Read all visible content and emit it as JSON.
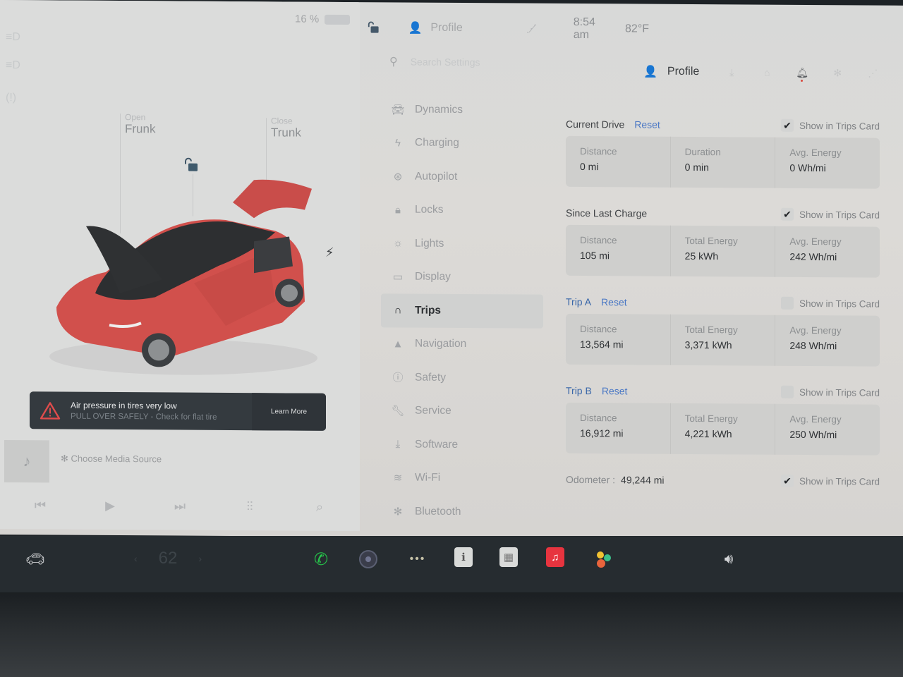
{
  "status_bar": {
    "battery_percent": "16 %",
    "profile_label": "Profile",
    "time": "8:54 am",
    "outside_temp": "82°F"
  },
  "left_panel": {
    "frunk": {
      "action": "Open",
      "label": "Frunk"
    },
    "trunk": {
      "action": "Close",
      "label": "Trunk"
    },
    "icons": [
      "low-beam-icon",
      "fog-light-icon",
      "tire-pressure-icon",
      "unlock-icon",
      "charge-port-icon"
    ],
    "alert": {
      "title": "Air pressure in tires very low",
      "subtitle": "PULL OVER SAFELY - Check for flat tire",
      "button": "Learn More"
    },
    "media": {
      "source_label": "Choose Media Source",
      "controls": [
        "previous",
        "play",
        "next",
        "equalizer",
        "search"
      ]
    }
  },
  "settings": {
    "search_placeholder": "Search Settings",
    "header": {
      "profile_label": "Profile",
      "icons": [
        "download-icon",
        "homelink-icon",
        "notification-bell-icon",
        "bluetooth-icon",
        "no-signal-icon"
      ]
    },
    "nav": [
      {
        "label": "Dynamics",
        "icon": "car-icon"
      },
      {
        "label": "Charging",
        "icon": "bolt-icon"
      },
      {
        "label": "Autopilot",
        "icon": "steering-wheel-icon"
      },
      {
        "label": "Locks",
        "icon": "lock-icon"
      },
      {
        "label": "Lights",
        "icon": "light-bulb-icon"
      },
      {
        "label": "Display",
        "icon": "display-icon"
      },
      {
        "label": "Trips",
        "icon": "trips-icon",
        "active": true
      },
      {
        "label": "Navigation",
        "icon": "navigation-arrow-icon"
      },
      {
        "label": "Safety",
        "icon": "safety-alert-icon"
      },
      {
        "label": "Service",
        "icon": "wrench-icon"
      },
      {
        "label": "Software",
        "icon": "download-icon"
      },
      {
        "label": "Wi-Fi",
        "icon": "wifi-icon"
      },
      {
        "label": "Bluetooth",
        "icon": "bluetooth-icon"
      }
    ],
    "trips": {
      "show_card_label": "Show in Trips Card",
      "reset_label": "Reset",
      "sections": [
        {
          "title": "Current Drive",
          "has_reset": true,
          "title_is_link": false,
          "show_in_card": true,
          "stats": [
            {
              "label": "Distance",
              "value": "0 mi"
            },
            {
              "label": "Duration",
              "value": "0 min"
            },
            {
              "label": "Avg. Energy",
              "value": "0 Wh/mi"
            }
          ]
        },
        {
          "title": "Since Last Charge",
          "has_reset": false,
          "title_is_link": false,
          "show_in_card": true,
          "stats": [
            {
              "label": "Distance",
              "value": "105 mi"
            },
            {
              "label": "Total Energy",
              "value": "25 kWh"
            },
            {
              "label": "Avg. Energy",
              "value": "242 Wh/mi"
            }
          ]
        },
        {
          "title": "Trip A",
          "has_reset": true,
          "title_is_link": true,
          "show_in_card": false,
          "stats": [
            {
              "label": "Distance",
              "value": "13,564 mi"
            },
            {
              "label": "Total Energy",
              "value": "3,371 kWh"
            },
            {
              "label": "Avg. Energy",
              "value": "248 Wh/mi"
            }
          ]
        },
        {
          "title": "Trip B",
          "has_reset": true,
          "title_is_link": true,
          "show_in_card": false,
          "stats": [
            {
              "label": "Distance",
              "value": "16,912 mi"
            },
            {
              "label": "Total Energy",
              "value": "4,221 kWh"
            },
            {
              "label": "Avg. Energy",
              "value": "250 Wh/mi"
            }
          ]
        }
      ],
      "odometer": {
        "label": "Odometer :",
        "value": "49,244 mi",
        "show_in_card": true
      }
    }
  },
  "taskbar": {
    "cabin_temp": "62",
    "apps": [
      "car-icon",
      "phone-icon",
      "camera-icon",
      "more-apps-icon",
      "manual-icon",
      "calendar-icon",
      "music-icon",
      "arcade-icon",
      "volume-icon"
    ],
    "colors": {
      "phone": "#26c24a",
      "music": "#e7343f"
    }
  }
}
